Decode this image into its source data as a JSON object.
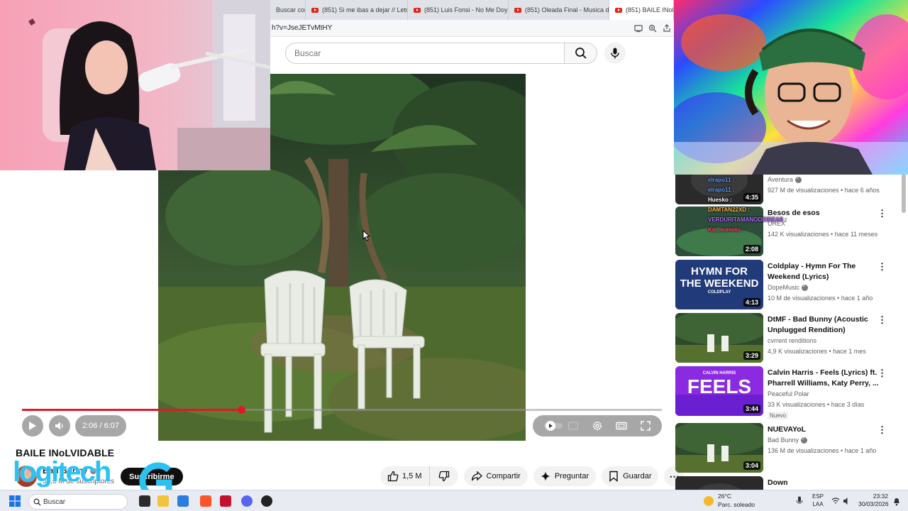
{
  "browser": {
    "tabs": [
      {
        "label": "Buscar con",
        "youtube": false
      },
      {
        "label": "(851) Si me ibas a dejar // Letra",
        "youtube": true
      },
      {
        "label": "(851) Luis Fonsi - No Me Doy P",
        "youtube": true
      },
      {
        "label": "(851) Oleada Final - Musica de",
        "youtube": true
      },
      {
        "label": "(851) BAILE INoLVID",
        "youtube": true
      }
    ],
    "url_fragment": "h?v=JseJETvMtHY"
  },
  "search": {
    "placeholder": "Buscar"
  },
  "player": {
    "time": "2:06 / 6:07",
    "progress_fraction": 0.343
  },
  "video": {
    "title": "BAILE INoLVIDABLE",
    "channel": "Bad Bunny",
    "subscribers": "59,6 M de suscriptores",
    "subscribe_label": "Suscribirme",
    "likes": "1,5 M",
    "share_label": "Compartir",
    "ask_label": "Preguntar",
    "save_label": "Guardar"
  },
  "recommendations": [
    {
      "title": "",
      "channel": "Aventura",
      "verified": true,
      "meta": "927 M de visualizaciones • hace 6 años",
      "duration": "4:35",
      "theme": "dark"
    },
    {
      "title": "Besos de esos",
      "channel": "UREX",
      "verified": false,
      "meta": "142 K visualizaciones • hace 11 meses",
      "duration": "2:08",
      "theme": "tropical"
    },
    {
      "title": "Coldplay - Hymn For The Weekend (Lyrics)",
      "channel": "DopeMusic",
      "verified": true,
      "meta": "10 M de visualizaciones • hace 1 año",
      "duration": "4:13",
      "theme": "hymn"
    },
    {
      "title": "DtMF - Bad Bunny (Acoustic Unplugged Rendition)",
      "channel": "cvrrent renditions",
      "verified": false,
      "meta": "4,9 K visualizaciones • hace 1 mes",
      "duration": "3:29",
      "theme": "chairs"
    },
    {
      "title": "Calvin Harris - Feels (Lyrics) ft. Pharrell Williams, Katy Perry, ...",
      "channel": "Peaceful Polar",
      "verified": false,
      "meta": "33 K visualizaciones • hace 3 días",
      "duration": "3:44",
      "theme": "feels",
      "badge": "Nuevo"
    },
    {
      "title": "NUEVAYoL",
      "channel": "Bad Bunny",
      "verified": true,
      "meta": "136 M de visualizaciones • hace 1 año",
      "duration": "3:04",
      "theme": "chairs"
    },
    {
      "title": "Down",
      "channel": "",
      "verified": false,
      "meta": "",
      "duration": "",
      "theme": "dark"
    }
  ],
  "thumb_text": {
    "hymn_line1": "HYMN FOR",
    "hymn_line2": "THE WEEKEND",
    "hymn_sub": "COLDPLAY",
    "feels_brand": "CALVIN HARRIS",
    "feels_word": "FEELS"
  },
  "chat": [
    {
      "user": "elrapo11",
      "text": "",
      "color": "#5b9bff"
    },
    {
      "user": "elrapo11",
      "text": "",
      "color": "#5b9bff"
    },
    {
      "user": "Huesko",
      "text": "",
      "color": "#ffffff"
    },
    {
      "user": "DAMTAN22XD",
      "text": "",
      "color": "#ffb547"
    },
    {
      "user": "VERDURITAMANODEIDEAS",
      "text": "",
      "color": "#b26bff"
    },
    {
      "user": "Kai_sumoto",
      "text": "",
      "color": "#ff4d6d"
    }
  ],
  "overlay": {
    "logitech_text": "logitech"
  },
  "taskbar": {
    "search_placeholder": "Buscar",
    "temperature": "26°C",
    "weather": "Parc. soleado",
    "lang_line1": "ESP",
    "lang_line2": "LAA",
    "time": "23:32",
    "date": "30/03/2026"
  },
  "colors": {
    "progress": "#e0192a",
    "logitech": "#2bc2f2"
  }
}
